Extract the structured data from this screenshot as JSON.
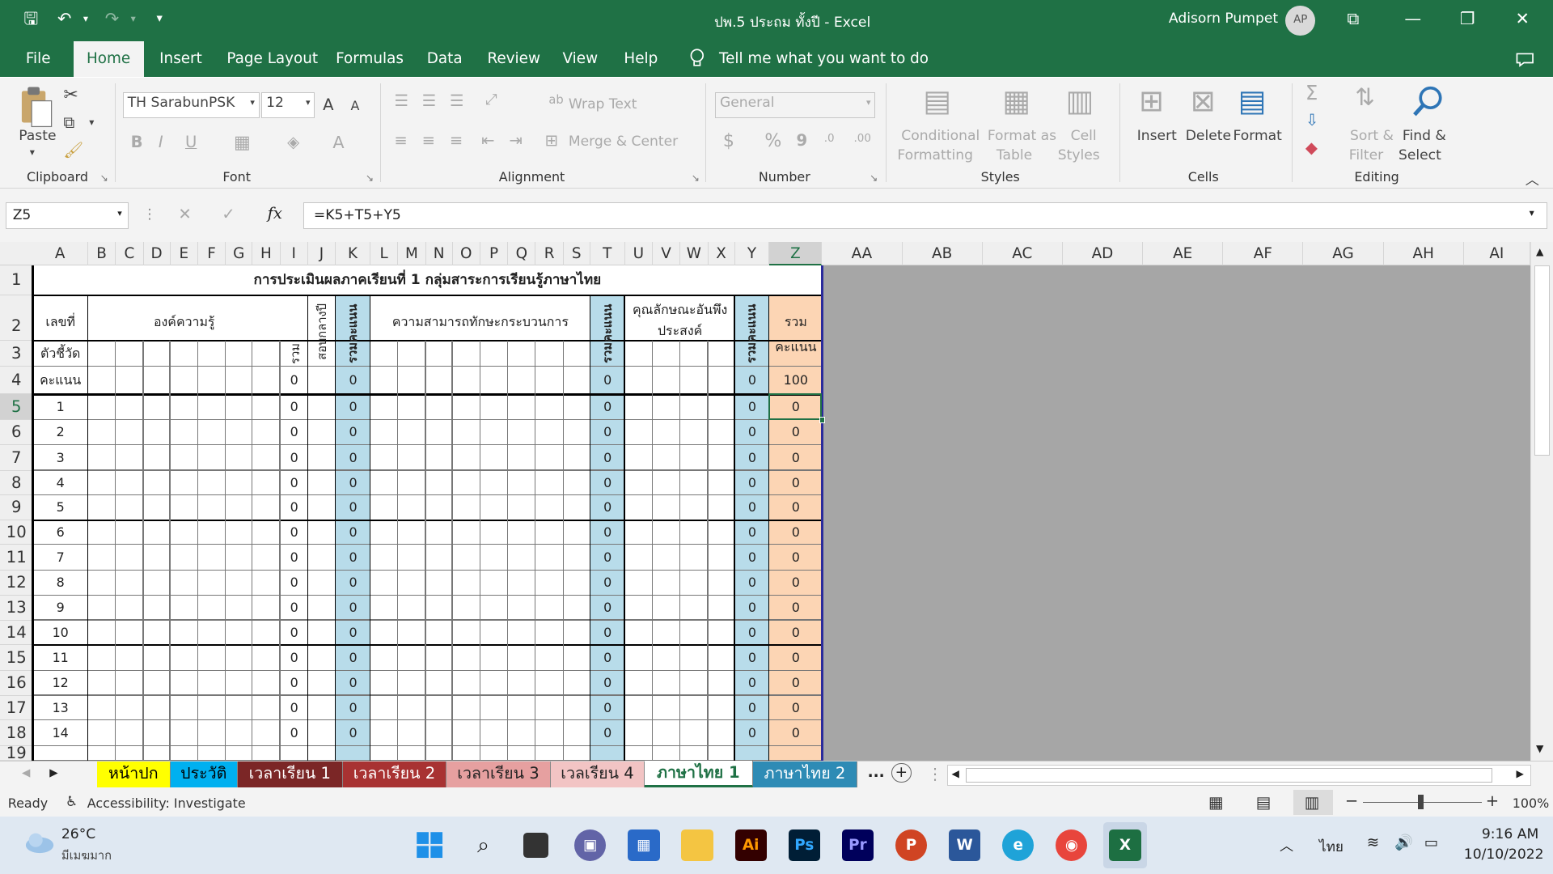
{
  "window": {
    "title": "ปพ.5 ประถม ทั้งปี  -  Excel",
    "user": "Adisorn Pumpet",
    "initials": "AP"
  },
  "qat": {
    "save": "🖫",
    "undo": "↶",
    "redo": "↷",
    "custom": "▾"
  },
  "controls": {
    "ribbon_display": "⧉",
    "minimize": "—",
    "restore": "❐",
    "close": "✕"
  },
  "tabs": [
    "File",
    "Home",
    "Insert",
    "Page Layout",
    "Formulas",
    "Data",
    "Review",
    "View",
    "Help"
  ],
  "tell_me": "Tell me what you want to do",
  "ribbon": {
    "clipboard": {
      "paste": "Paste",
      "group": "Clipboard"
    },
    "font": {
      "name": "TH SarabunPSK",
      "size": "12",
      "group": "Font",
      "bold": "B",
      "italic": "I",
      "underline": "U",
      "grow": "A",
      "shrink": "A",
      "color": "A"
    },
    "alignment": {
      "wrap": "Wrap Text",
      "merge": "Merge & Center",
      "group": "Alignment"
    },
    "number": {
      "format": "General",
      "currency": "$",
      "percent": "%",
      "comma": "9",
      "inc": ".00",
      "dec": ".0",
      "group": "Number"
    },
    "styles": {
      "cond1": "Conditional",
      "cond2": "Formatting",
      "fmt1": "Format as",
      "fmt2": "Table",
      "cell1": "Cell",
      "cell2": "Styles",
      "group": "Styles"
    },
    "cells": {
      "insert": "Insert",
      "delete": "Delete",
      "format": "Format",
      "group": "Cells"
    },
    "editing": {
      "sort1": "Sort &",
      "sort2": "Filter",
      "find1": "Find &",
      "find2": "Select",
      "group": "Editing"
    }
  },
  "formula_bar": {
    "name_box": "Z5",
    "formula": "=K5+T5+Y5",
    "fx": "fx"
  },
  "columns": [
    "A",
    "B",
    "C",
    "D",
    "E",
    "F",
    "G",
    "H",
    "I",
    "J",
    "K",
    "L",
    "M",
    "N",
    "O",
    "P",
    "Q",
    "R",
    "S",
    "T",
    "U",
    "V",
    "W",
    "X",
    "Y",
    "Z",
    "AA",
    "AB",
    "AC",
    "AD",
    "AE",
    "AF",
    "AG",
    "AH",
    "AI"
  ],
  "rows": [
    "1",
    "2",
    "3",
    "4",
    "5",
    "6",
    "7",
    "8",
    "9",
    "10",
    "11",
    "12",
    "13",
    "14",
    "15",
    "16",
    "17",
    "18",
    "19"
  ],
  "sheet": {
    "title": "การประเมินผลภาคเรียนที่ 1    กลุ่มสาระการเรียนรู้ภาษาไทย",
    "h_no": "เลขที่",
    "h_knowledge": "องค์ความรู้",
    "h_midterm": "สอบกลางปี",
    "h_total": "รวมคะแนน",
    "h_skills": "ความสามารถทักษะกระบวนการ",
    "h_traits1": "คุณลักษณะอันพึง",
    "h_traits2": "ประสงค์",
    "h_sum1": "รวม",
    "h_sum2": "คะแนน",
    "h_indicator": "ตัวชี้วัด",
    "h_rum": "รวม",
    "h_score": "คะแนน",
    "score_row": {
      "i": "0",
      "k": "0",
      "t": "0",
      "y": "0",
      "z": "100"
    },
    "students": [
      {
        "no": "1",
        "i": "0",
        "k": "0",
        "t": "0",
        "y": "0",
        "z": "0"
      },
      {
        "no": "2",
        "i": "0",
        "k": "0",
        "t": "0",
        "y": "0",
        "z": "0"
      },
      {
        "no": "3",
        "i": "0",
        "k": "0",
        "t": "0",
        "y": "0",
        "z": "0"
      },
      {
        "no": "4",
        "i": "0",
        "k": "0",
        "t": "0",
        "y": "0",
        "z": "0"
      },
      {
        "no": "5",
        "i": "0",
        "k": "0",
        "t": "0",
        "y": "0",
        "z": "0"
      },
      {
        "no": "6",
        "i": "0",
        "k": "0",
        "t": "0",
        "y": "0",
        "z": "0"
      },
      {
        "no": "7",
        "i": "0",
        "k": "0",
        "t": "0",
        "y": "0",
        "z": "0"
      },
      {
        "no": "8",
        "i": "0",
        "k": "0",
        "t": "0",
        "y": "0",
        "z": "0"
      },
      {
        "no": "9",
        "i": "0",
        "k": "0",
        "t": "0",
        "y": "0",
        "z": "0"
      },
      {
        "no": "10",
        "i": "0",
        "k": "0",
        "t": "0",
        "y": "0",
        "z": "0"
      },
      {
        "no": "11",
        "i": "0",
        "k": "0",
        "t": "0",
        "y": "0",
        "z": "0"
      },
      {
        "no": "12",
        "i": "0",
        "k": "0",
        "t": "0",
        "y": "0",
        "z": "0"
      },
      {
        "no": "13",
        "i": "0",
        "k": "0",
        "t": "0",
        "y": "0",
        "z": "0"
      },
      {
        "no": "14",
        "i": "0",
        "k": "0",
        "t": "0",
        "y": "0",
        "z": "0"
      }
    ]
  },
  "sheet_tabs": [
    {
      "label": "หน้าปก",
      "bg": "#ffff00",
      "fg": "#000000"
    },
    {
      "label": "ประวัติ",
      "bg": "#00b0f0",
      "fg": "#000000"
    },
    {
      "label": "เวลาเรียน 1",
      "bg": "#7b2626",
      "fg": "#ffffff"
    },
    {
      "label": "เวลาเรียน 2",
      "bg": "#a83232",
      "fg": "#ffffff"
    },
    {
      "label": "เวลาเรียน 3",
      "bg": "#e6a0a0",
      "fg": "#222222"
    },
    {
      "label": "เวลเรียน 4",
      "bg": "#f2c4c4",
      "fg": "#222222"
    },
    {
      "label": "ภาษาไทย 1",
      "bg": "#ffffff",
      "fg": "#1f7145"
    },
    {
      "label": "ภาษาไทย 2",
      "bg": "#2e8bb5",
      "fg": "#ffffff"
    }
  ],
  "more_tabs": "...",
  "status": {
    "ready": "Ready",
    "accessibility": "Accessibility: Investigate",
    "zoom": "100%"
  },
  "taskbar": {
    "temp": "26°C",
    "weather": "มีเมฆมาก",
    "lang": "ไทย",
    "time": "9:16 AM",
    "date": "10/10/2022"
  },
  "colors": {
    "excel_green": "#1f7145",
    "blue_col": "#b8dcea",
    "orange_col": "#fcd5b4",
    "grey_bg": "#a6a6a6"
  }
}
